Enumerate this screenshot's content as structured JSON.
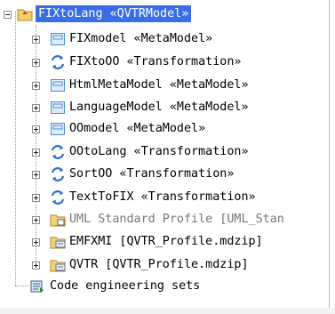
{
  "tree": {
    "root": {
      "label": "FIXtoLang «QVTRModel»",
      "icon": "package-icon"
    },
    "children": [
      {
        "label": "FIXmodel «MetaModel»",
        "icon": "metamodel-icon"
      },
      {
        "label": "FIXtoOO «Transformation»",
        "icon": "transformation-icon"
      },
      {
        "label": "HtmlMetaModel «MetaModel»",
        "icon": "metamodel-icon"
      },
      {
        "label": "LanguageModel «MetaModel»",
        "icon": "metamodel-icon"
      },
      {
        "label": "OOmodel «MetaModel»",
        "icon": "metamodel-icon"
      },
      {
        "label": "OOtoLang «Transformation»",
        "icon": "transformation-icon"
      },
      {
        "label": "SortOO «Transformation»",
        "icon": "transformation-icon"
      },
      {
        "label": "TextToFIX «Transformation»",
        "icon": "transformation-icon"
      },
      {
        "label": "UML Standard Profile [UML_Stan",
        "icon": "profile-package-icon"
      },
      {
        "label": "EMFXMI [QVTR_Profile.mdzip]",
        "icon": "used-profile-icon"
      },
      {
        "label": "QVTR [QVTR_Profile.mdzip]",
        "icon": "used-profile-icon"
      }
    ],
    "footer": {
      "label": "Code engineering sets",
      "icon": "code-engineering-icon"
    }
  },
  "colors": {
    "selection": "#3a6ee6",
    "metamodel": "#4f8fd6",
    "transformation": "#2f6fcf",
    "package": "#e8b64a"
  }
}
